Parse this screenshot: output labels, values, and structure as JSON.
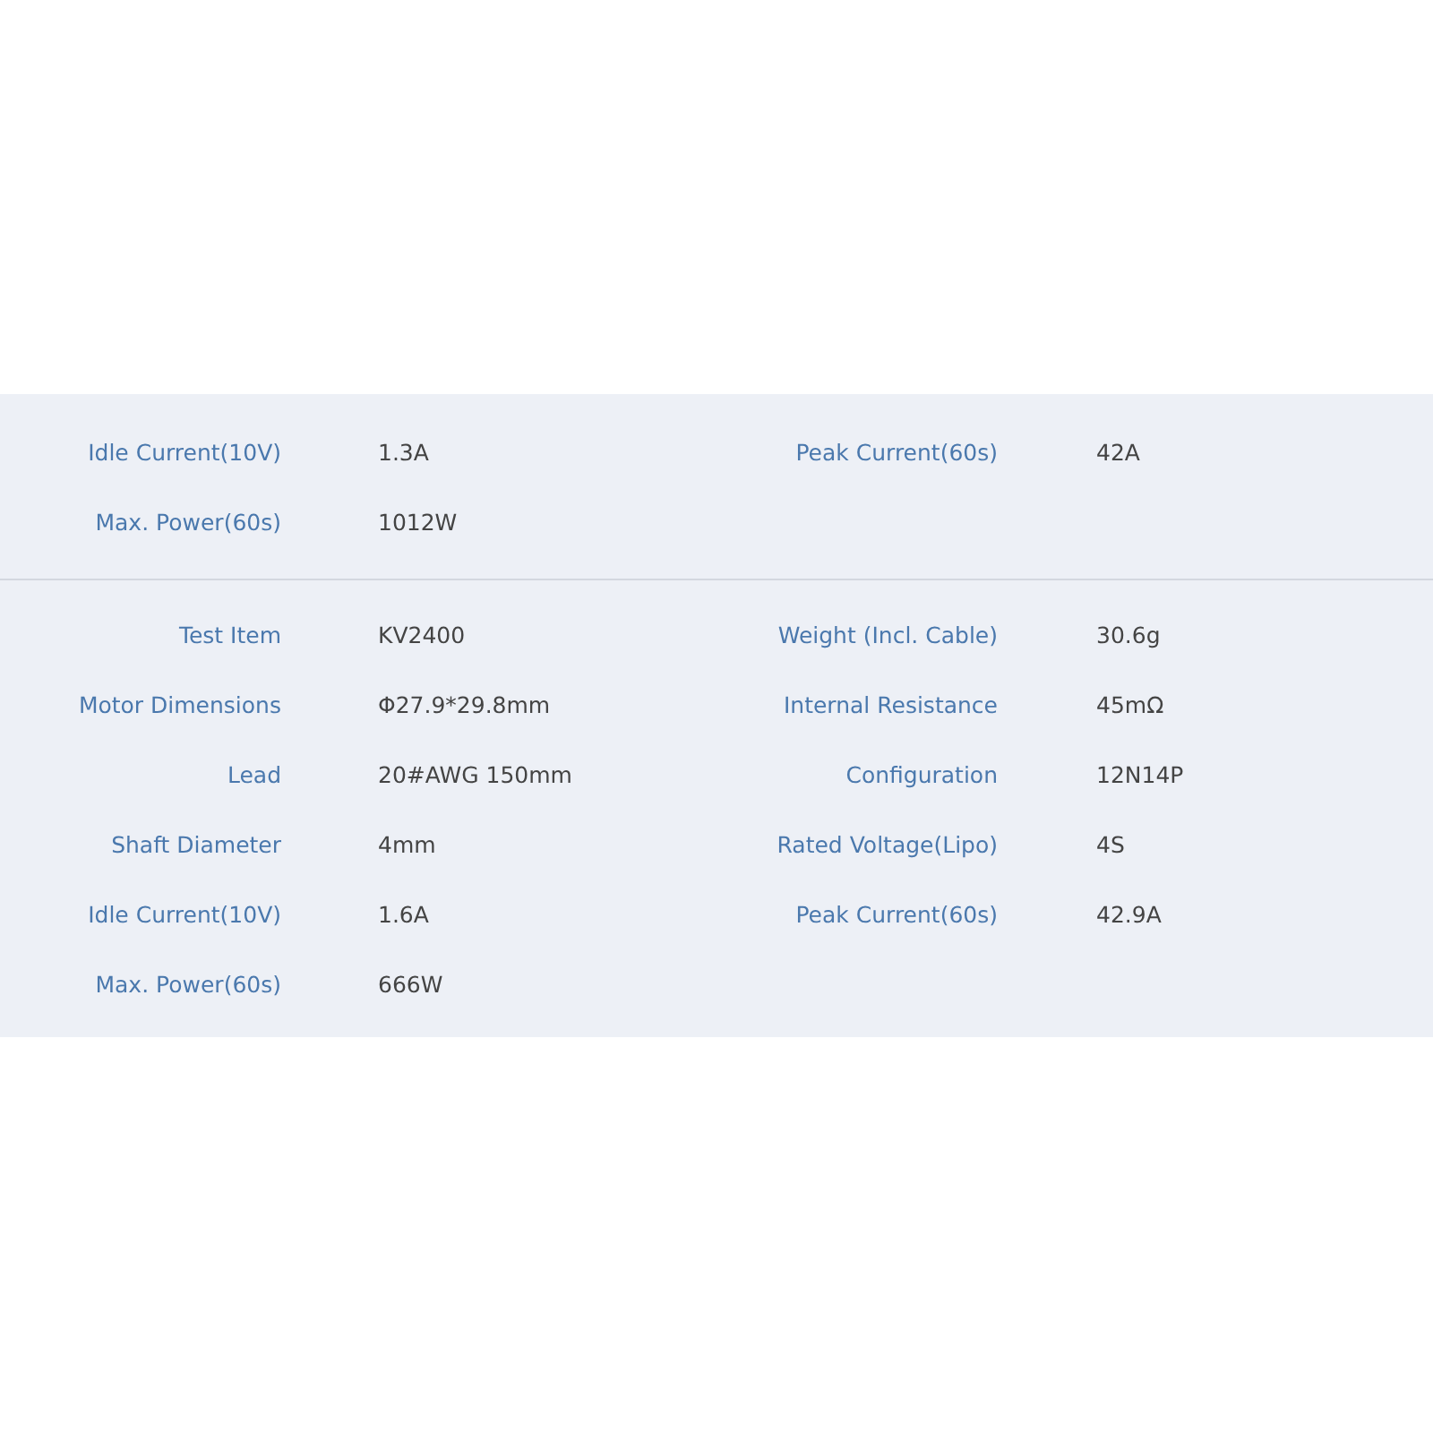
{
  "sections": [
    {
      "rows": [
        {
          "label": "Idle Current(10V)",
          "value": "1.3A",
          "label_2": "Peak Current(60s)",
          "value_2": "42A"
        },
        {
          "label": "Max. Power(60s)",
          "value": "1012W"
        }
      ]
    },
    {
      "rows": [
        {
          "label": "Test Item",
          "value": "KV2400",
          "label_2": "Weight (Incl. Cable)",
          "value_2": "30.6g"
        },
        {
          "label": "Motor Dimensions",
          "value": "Φ27.9*29.8mm",
          "label_2": "Internal Resistance",
          "value_2": "45mΩ"
        },
        {
          "label": "Lead",
          "value": "20#AWG 150mm",
          "label_2": "Configuration",
          "value_2": "12N14P"
        },
        {
          "label": "Shaft Diameter",
          "value": "4mm",
          "label_2": "Rated Voltage(Lipo)",
          "value_2": "4S"
        },
        {
          "label": "Idle Current(10V)",
          "value": "1.6A",
          "label_2": "Peak Current(60s)",
          "value_2": "42.9A"
        },
        {
          "label": "Max. Power(60s)",
          "value": "666W"
        }
      ]
    }
  ]
}
